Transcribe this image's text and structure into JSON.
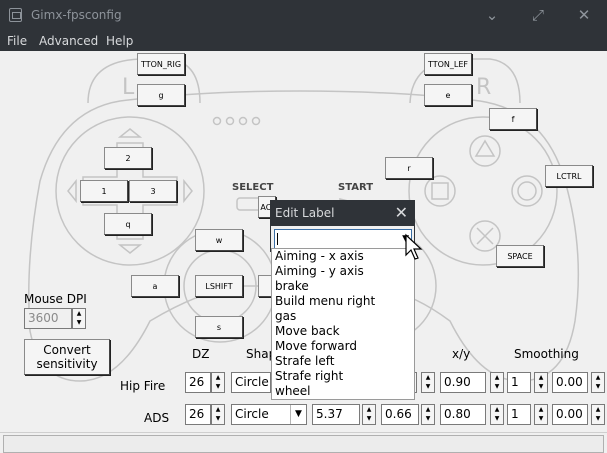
{
  "window": {
    "title": "Gimx-fpsconfig"
  },
  "menu": {
    "file": "File",
    "advanced": "Advanced",
    "help": "Help"
  },
  "pad": {
    "select_label": "SELECT",
    "start_label": "START",
    "l_letter": "L",
    "r_letter": "R"
  },
  "buttons": {
    "l1": "TTON_RIG",
    "l2": "g",
    "r1": "TTON_LEF",
    "r2": "e",
    "up": "2",
    "left": "1",
    "right": "3",
    "down": "q",
    "triangle": "f",
    "square": "r",
    "circle": "LCTRL",
    "cross": "SPACE",
    "select": "ACI",
    "ls_up": "w",
    "ls_left": "a",
    "ls_center": "LSHIFT",
    "ls_down": "s"
  },
  "mouse_dpi": {
    "label": "Mouse DPI",
    "value": "3600"
  },
  "convert": {
    "line1": "Convert",
    "line2": "sensitivity"
  },
  "headers": {
    "dz": "DZ",
    "shape": "Shap",
    "xy": "x/y",
    "smoothing": "Smoothing"
  },
  "rows": {
    "hipfire": {
      "label": "Hip Fire",
      "dz": "26",
      "shape": "Circle",
      "xy": "0.90",
      "buffer": "1",
      "filter": "0.00"
    },
    "ads": {
      "label": "ADS",
      "dz": "26",
      "shape": "Circle",
      "sens": "5.37",
      "accel": "0.66",
      "xy": "0.80",
      "buffer": "1",
      "filter": "0.00"
    }
  },
  "dialog": {
    "title": "Edit Label",
    "options": [
      "Aiming - x axis",
      "Aiming - y axis",
      "brake",
      "Build menu right",
      "gas",
      "Move back",
      "Move forward",
      "Strafe left",
      "Strafe right",
      "wheel"
    ]
  }
}
